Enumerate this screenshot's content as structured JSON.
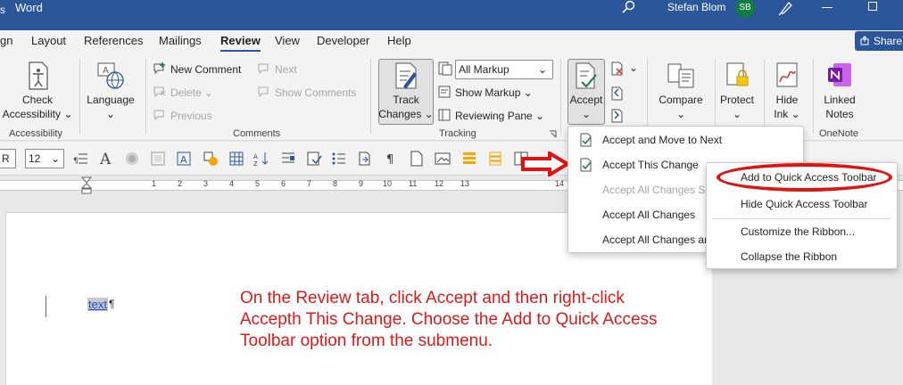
{
  "titlebar": {
    "app_prefix": "s",
    "app_name": "Word",
    "user_name": "Stefan Blom",
    "user_initials": "SB"
  },
  "tabs": [
    "gn",
    "Layout",
    "References",
    "Mailings",
    "Review",
    "View",
    "Developer",
    "Help"
  ],
  "active_tab": "Review",
  "share_label": "Share",
  "ribbon": {
    "accessibility": {
      "check_line1": "Check",
      "check_line2": "Accessibility",
      "group": "Accessibility"
    },
    "language": {
      "label": "Language"
    },
    "comments": {
      "new_comment": "New Comment",
      "delete": "Delete",
      "previous": "Previous",
      "next": "Next",
      "show_comments": "Show Comments",
      "group": "Comments"
    },
    "tracking": {
      "track_line1": "Track",
      "track_line2": "Changes",
      "markup_value": "All Markup",
      "show_markup": "Show Markup",
      "reviewing_pane": "Reviewing Pane",
      "group": "Tracking"
    },
    "accept": {
      "label": "Accept"
    },
    "compare": {
      "label": "Compare"
    },
    "protect": {
      "label": "Protect"
    },
    "hide_ink": {
      "line1": "Hide",
      "line2": "Ink"
    },
    "linked_notes": {
      "line1": "Linked",
      "line2": "Notes",
      "group": "OneNote"
    }
  },
  "format_strip": {
    "font_name": "R",
    "font_size": "12"
  },
  "ruler_numbers": [
    "1",
    "2",
    "3",
    "4",
    "5",
    "6",
    "7",
    "8",
    "9",
    "10",
    "11",
    "12",
    "13",
    "14"
  ],
  "document": {
    "text": "text",
    "pilcrow": "¶"
  },
  "instruction_note": "On the Review tab, click Accept and then right-click Accepth This Change. Choose the Add to Quick Access Toolbar option from the submenu.",
  "accept_menu": {
    "items": [
      {
        "label": "Accept and Move to Next",
        "enabled": true
      },
      {
        "label": "Accept This Change",
        "enabled": true
      },
      {
        "label": "Accept All Changes Sh",
        "enabled": false
      },
      {
        "label": "Accept All Changes",
        "enabled": true
      },
      {
        "label": "Accept All Changes ar",
        "enabled": true
      }
    ]
  },
  "context_menu": {
    "items": [
      {
        "label": "Add to Quick Access Toolbar"
      },
      {
        "label": "Hide Quick Access Toolbar"
      },
      {
        "label": "Customize the Ribbon..."
      },
      {
        "label": "Collapse the Ribbon"
      }
    ]
  },
  "colors": {
    "word_blue": "#2b579a",
    "annotation_red": "#d81b1b",
    "highlight_red": "#e01313"
  }
}
